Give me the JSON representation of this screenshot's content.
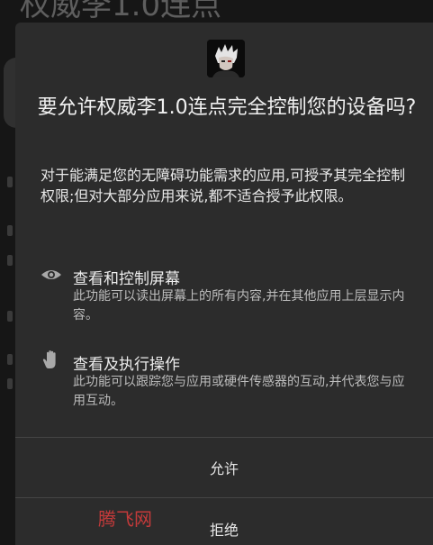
{
  "background": {
    "title": "权威李1.0连点"
  },
  "dialog": {
    "app_icon": "app-avatar-icon",
    "title": "要允许权威李1.0连点完全控制您的设备吗?",
    "description": "对于能满足您的无障碍功能需求的应用,可授予其完全控制权限;但对大部分应用来说,都不适合授予此权限。",
    "permissions": [
      {
        "icon": "eye-icon",
        "title": "查看和控制屏幕",
        "description": "此功能可以读出屏幕上的所有内容,并在其他应用上层显示内容。"
      },
      {
        "icon": "hand-icon",
        "title": "查看及执行操作",
        "description": "此功能可以跟踪您与应用或硬件传感器的互动,并代表您与应用互动。"
      }
    ],
    "allow_label": "允许",
    "deny_label": "拒绝"
  },
  "watermark": "腾飞网",
  "colors": {
    "dialog_bg": "#2c2c2c",
    "text_primary": "#f0f0f0",
    "text_secondary": "#bdbdbd",
    "watermark": "#c43a3a"
  }
}
